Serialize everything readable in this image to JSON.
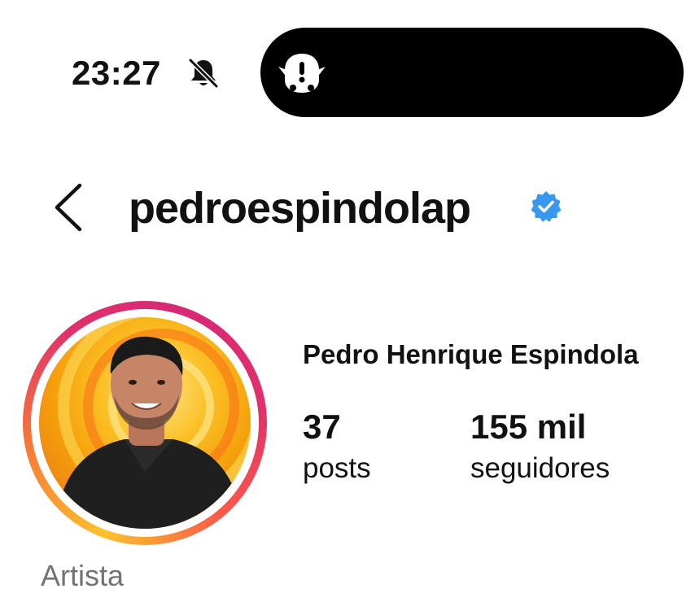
{
  "status_bar": {
    "time": "23:27",
    "silent_icon": "bell-slash-icon",
    "island_icon": "ghost-alert-icon"
  },
  "header": {
    "back_icon": "chevron-left-icon",
    "username": "pedroespindolap",
    "verified_icon": "verified-badge-icon",
    "verified_color": "#3897f0"
  },
  "profile": {
    "full_name": "Pedro Henrique Espindola",
    "category": "Artista",
    "ring_colors": [
      "#fcc12d",
      "#f77737",
      "#e1306c",
      "#d62976"
    ],
    "stats": [
      {
        "value": "37",
        "label": "posts"
      },
      {
        "value": "155 mil",
        "label": "seguidores"
      }
    ]
  }
}
